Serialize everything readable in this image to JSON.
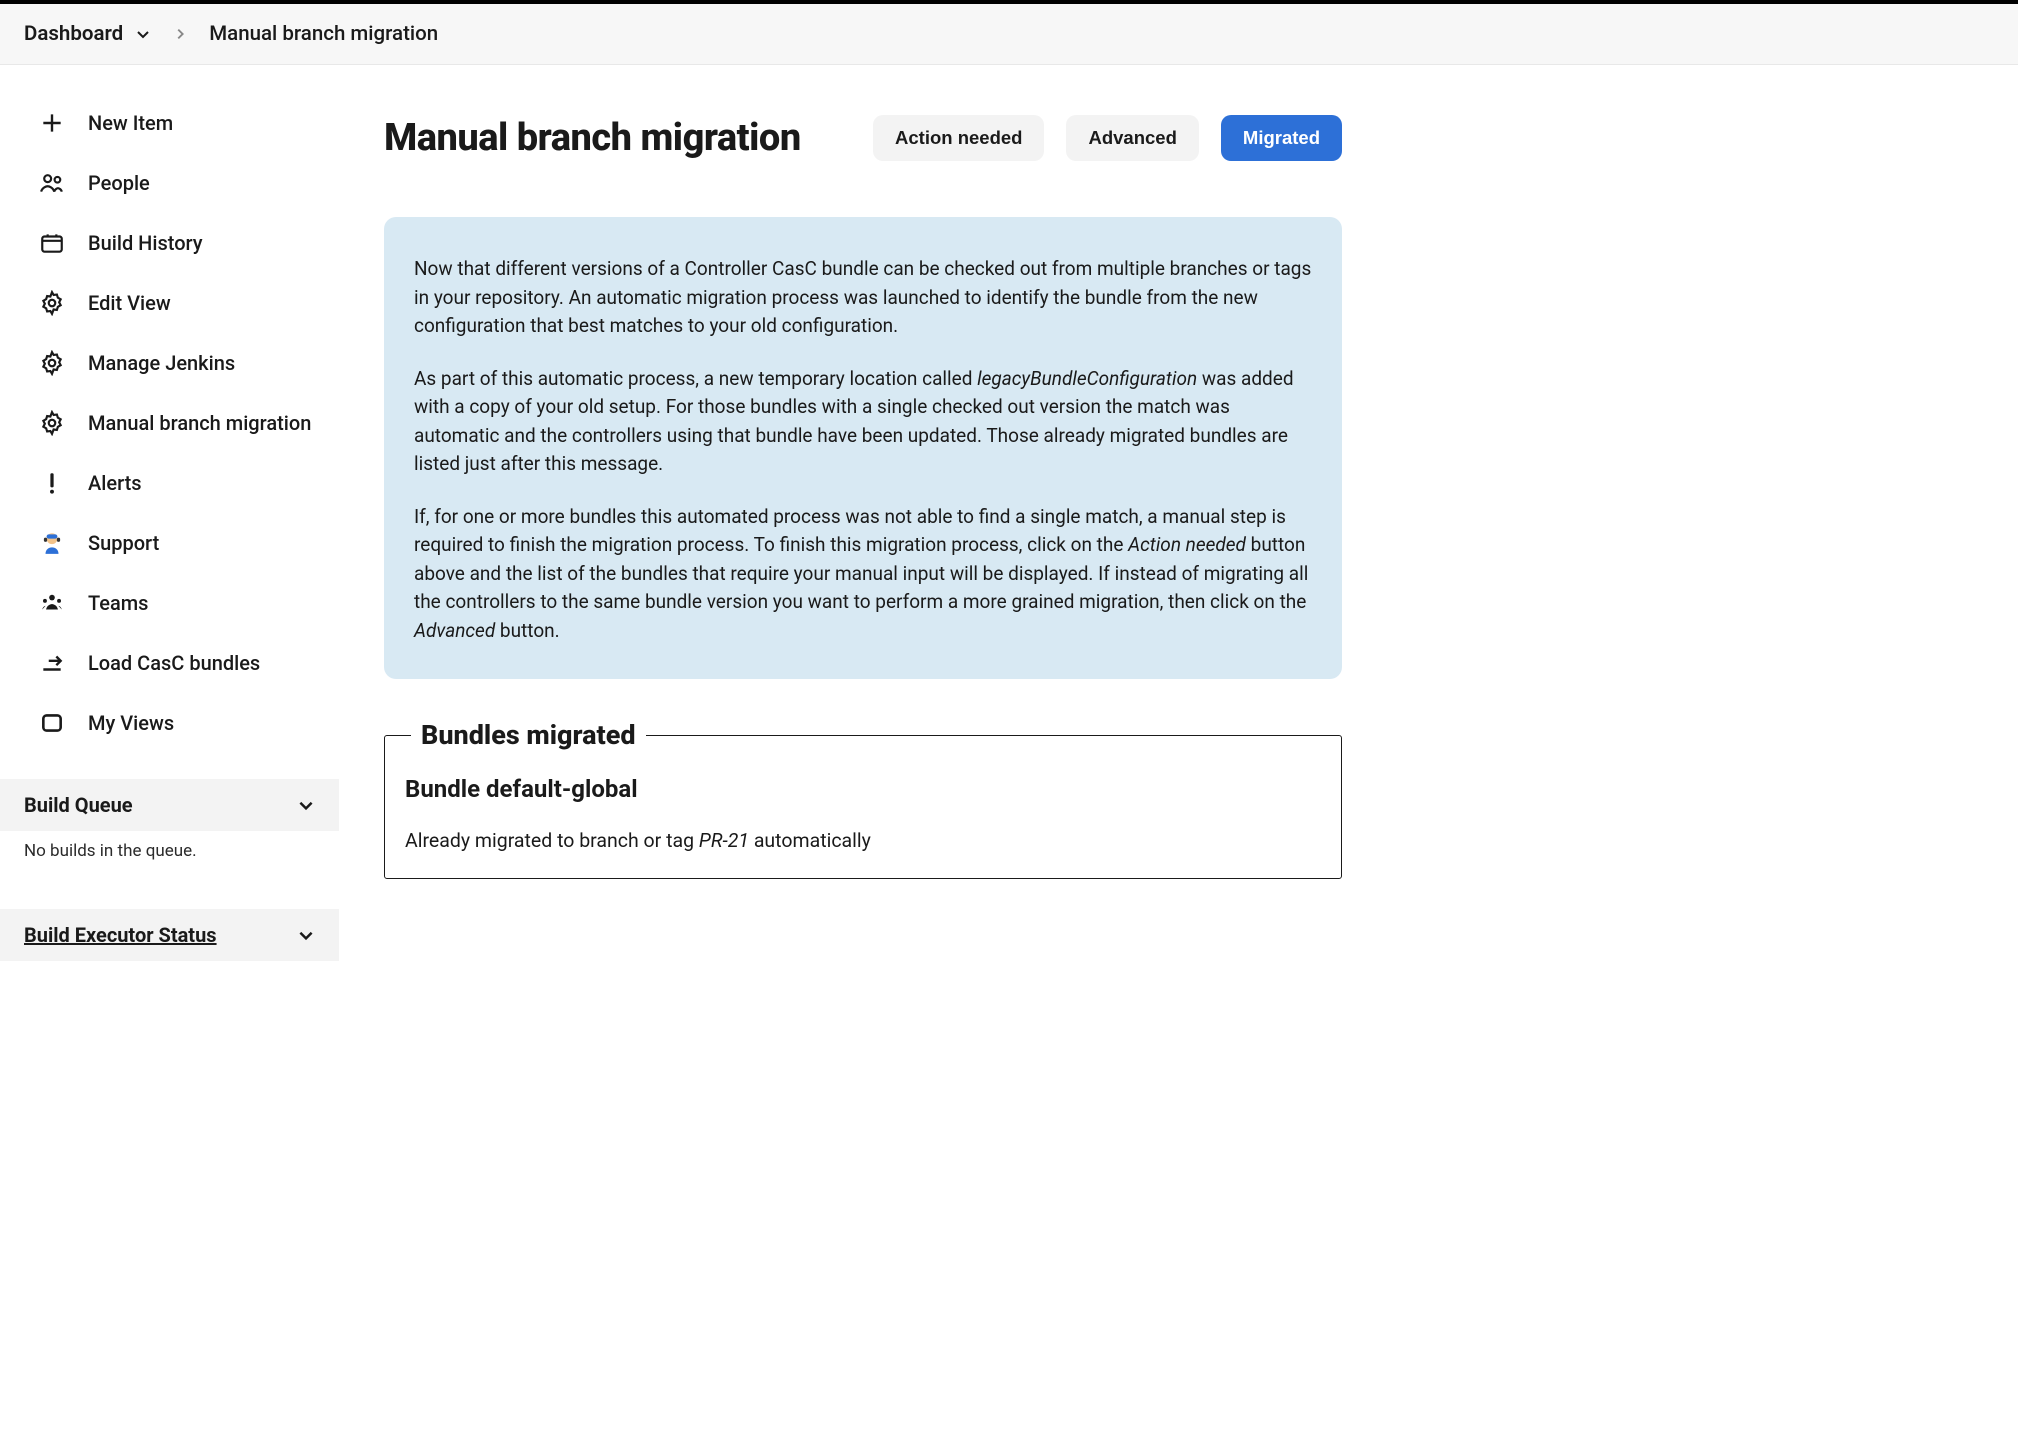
{
  "breadcrumb": {
    "root": "Dashboard",
    "page": "Manual branch migration"
  },
  "sidebar": {
    "items": [
      {
        "id": "new-item",
        "label": "New Item",
        "icon": "plus-icon"
      },
      {
        "id": "people",
        "label": "People",
        "icon": "people-icon"
      },
      {
        "id": "build-history",
        "label": "Build History",
        "icon": "history-icon"
      },
      {
        "id": "edit-view",
        "label": "Edit View",
        "icon": "gear-icon"
      },
      {
        "id": "manage-jenkins",
        "label": "Manage Jenkins",
        "icon": "gear-icon"
      },
      {
        "id": "manual-branch-migration",
        "label": "Manual branch migration",
        "icon": "gear-icon"
      },
      {
        "id": "alerts",
        "label": "Alerts",
        "icon": "alert-icon"
      },
      {
        "id": "support",
        "label": "Support",
        "icon": "support-icon"
      },
      {
        "id": "teams",
        "label": "Teams",
        "icon": "teams-icon"
      },
      {
        "id": "load-casc",
        "label": "Load CasC bundles",
        "icon": "load-icon"
      },
      {
        "id": "my-views",
        "label": "My Views",
        "icon": "my-views-icon"
      }
    ],
    "build_queue": {
      "title": "Build Queue",
      "empty": "No builds in the queue."
    },
    "executor": {
      "title": "Build Executor Status"
    }
  },
  "page": {
    "title": "Manual branch migration",
    "tabs": {
      "action_needed": "Action needed",
      "advanced": "Advanced",
      "migrated": "Migrated",
      "active": "migrated"
    },
    "info": {
      "p1": "Now that different versions of a Controller CasC bundle can be checked out from multiple branches or tags in your repository. An automatic migration process was launched to identify the bundle from the new configuration that best matches to your old configuration.",
      "p2_a": "As part of this automatic process, a new temporary location called ",
      "p2_em": "legacyBundleConfiguration",
      "p2_b": " was added with a copy of your old setup. For those bundles with a single checked out version the match was automatic and the controllers using that bundle have been updated. Those already migrated bundles are listed just after this message.",
      "p3_a": "If, for one or more bundles this automated process was not able to find a single match, a manual step is required to finish the migration process. To finish this migration process, click on the ",
      "p3_em1": "Action needed",
      "p3_b": " button above and the list of the bundles that require your manual input will be displayed. If instead of migrating all the controllers to the same bundle version you want to perform a more grained migration, then click on the ",
      "p3_em2": "Advanced",
      "p3_c": " button."
    },
    "migrated_section": {
      "legend": "Bundles migrated",
      "bundle_title": "Bundle default-global",
      "status_a": "Already migrated to branch or tag ",
      "status_em": "PR-21",
      "status_b": " automatically"
    }
  }
}
